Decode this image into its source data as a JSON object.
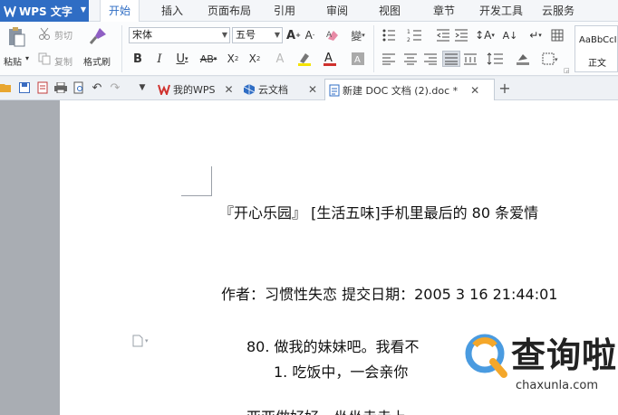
{
  "app": {
    "title": "WPS 文字"
  },
  "menu": {
    "tabs": [
      "开始",
      "插入",
      "页面布局",
      "引用",
      "审阅",
      "视图",
      "章节",
      "开发工具",
      "云服务"
    ],
    "active": "开始"
  },
  "ribbon": {
    "paste_label": "粘贴",
    "cut_label": "剪切",
    "copy_label": "复制",
    "format_painter_label": "格式刷",
    "font_name": "宋体",
    "font_size": "五号",
    "style_preview": "AaBbCcI",
    "style_name": "正文"
  },
  "tabs": [
    {
      "label": "我的WPS"
    },
    {
      "label": "云文档"
    },
    {
      "label": "新建 DOC 文档 (2).doc *"
    }
  ],
  "document": {
    "title_line": "『开心乐园』 [生活五味]手机里最后的 80 条爱情",
    "author_line": "作者：习惯性失恋    提交日期：2005 3 16 21:44:01",
    "para1": "80. 做我的妹妹吧。我看不",
    "para2": "1.   吃饭中，一会亲你",
    "para3": "亚亚做好好，坐坐走走上一"
  },
  "watermark": {
    "title": "查询啦",
    "url": "chaxunla.com"
  },
  "colors": {
    "accent": "#2f6dc4",
    "wps_red": "#d0312d"
  }
}
